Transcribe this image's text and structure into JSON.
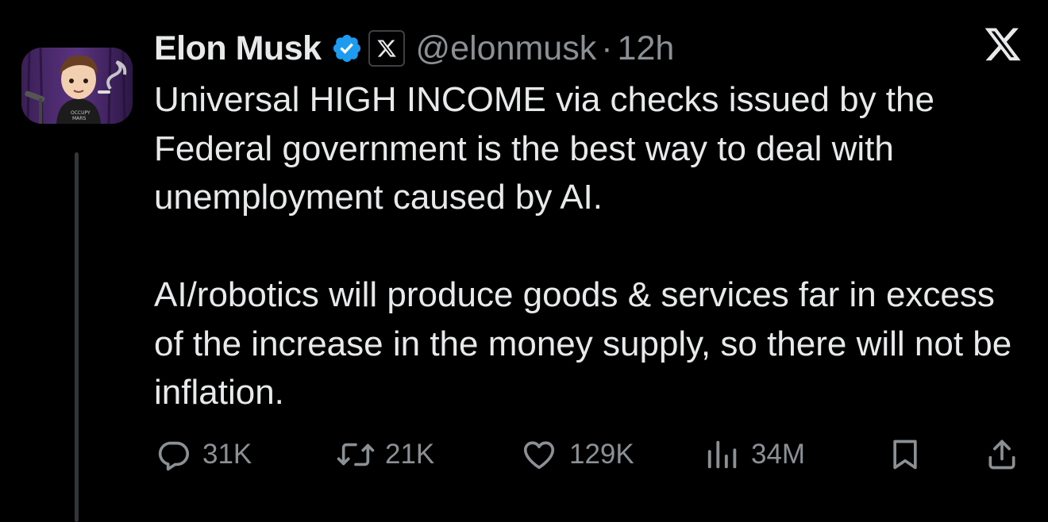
{
  "author": {
    "display_name": "Elon Musk",
    "handle": "@elonmusk",
    "separator": "·",
    "timestamp": "12h",
    "verified_badge_color": "#1d9bf0",
    "affiliate_icon": "x-logo-icon"
  },
  "platform_logo": "x-logo-icon",
  "tweet": {
    "paragraphs": [
      "Universal HIGH INCOME via checks issued by the Federal government is the best way to deal with unemployment caused by AI.",
      "AI/robotics will produce goods & services far in excess of the increase in the money supply, so there will not be inflation."
    ]
  },
  "actions": {
    "reply": {
      "icon": "reply-icon",
      "count": "31K"
    },
    "retweet": {
      "icon": "retweet-icon",
      "count": "21K"
    },
    "like": {
      "icon": "heart-icon",
      "count": "129K"
    },
    "views": {
      "icon": "views-icon",
      "count": "34M"
    },
    "bookmark": {
      "icon": "bookmark-icon"
    },
    "share": {
      "icon": "share-icon"
    }
  },
  "colors": {
    "background": "#000000",
    "text_primary": "#e7e9ea",
    "text_secondary": "#8b9095",
    "thread_line": "#333639"
  }
}
